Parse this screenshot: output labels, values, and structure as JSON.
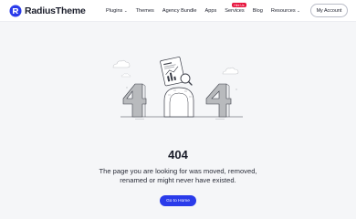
{
  "header": {
    "logo_text": "RadiusTheme",
    "nav": [
      {
        "label": "Plugins",
        "dropdown": true
      },
      {
        "label": "Themes",
        "dropdown": false
      },
      {
        "label": "Agency Bundle",
        "dropdown": false
      },
      {
        "label": "Apps",
        "dropdown": false
      },
      {
        "label": "Services",
        "dropdown": false,
        "badge": "Hire Us"
      },
      {
        "label": "Blog",
        "dropdown": false
      },
      {
        "label": "Resources",
        "dropdown": true
      }
    ],
    "account_label": "My Account"
  },
  "illustration": {
    "digits": "404"
  },
  "main": {
    "code": "404",
    "message": "The page you are looking for was moved, removed, renamed or might never have existed.",
    "home_button": "Go to Home"
  },
  "colors": {
    "accent": "#2a3bea",
    "badge": "#e7163f",
    "background": "#f5f6f8",
    "digit_gray": "#b8babd"
  },
  "icons": {
    "logo": "radius-logo-icon",
    "chevron": "chevron-down-icon",
    "document": "document-chart-icon",
    "magnifier": "magnifier-icon",
    "cloud": "cloud-icon"
  }
}
